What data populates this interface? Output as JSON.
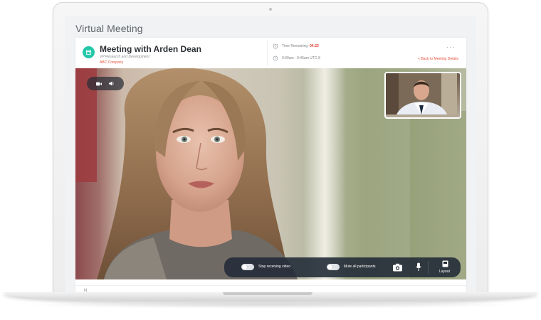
{
  "page": {
    "title": "Virtual Meeting"
  },
  "meeting": {
    "title": "Meeting with Arden Dean",
    "role": "VP Research and Development",
    "company": "ABC Company",
    "time_remaining_label": "Time Remaining:",
    "time_remaining_value": "04:23",
    "schedule": "9:00am - 9:45am UTC-8",
    "back_link": "< Back to Meeting Details",
    "more_menu": "···"
  },
  "controls": {
    "stop_video_label": "Stop receiving video",
    "mute_all_label": "Mute all participants",
    "layout_label": "Layout"
  },
  "notes": {
    "label": "N"
  },
  "colors": {
    "accent": "#22c7a9",
    "link": "#e8503a",
    "timer": "#e23b30",
    "control_bar": "#242c38"
  },
  "icons": [
    "meeting-calendar-icon",
    "alarm-clock-icon",
    "clock-icon",
    "video-camera-icon",
    "speaker-icon",
    "camera-switch-icon",
    "microphone-icon",
    "layout-icon"
  ]
}
